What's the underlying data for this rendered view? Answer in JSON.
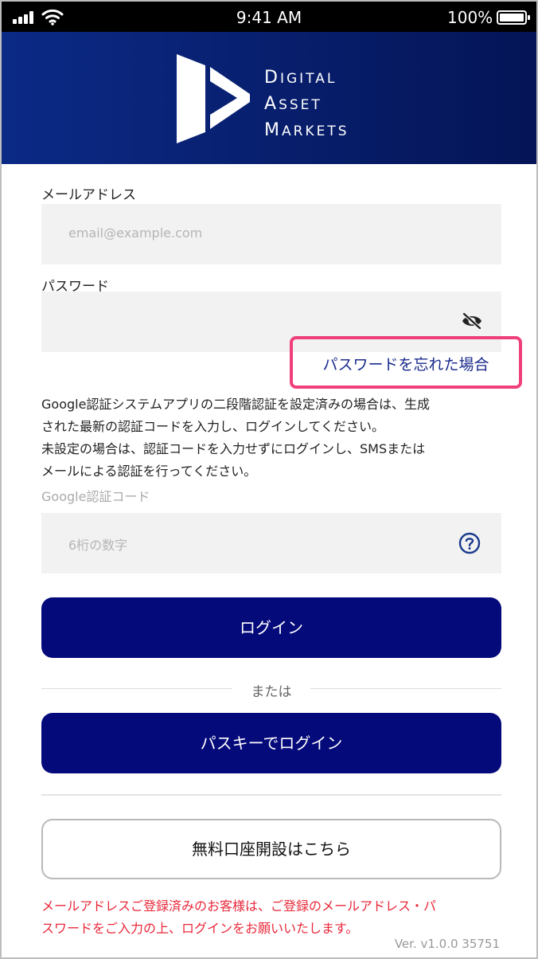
{
  "status_bar": {
    "time": "9:41 AM",
    "battery": "100%"
  },
  "logo": {
    "line1": [
      "D",
      "IGITAL"
    ],
    "line2": [
      "A",
      "SSET"
    ],
    "line3": [
      "M",
      "ARKETS"
    ]
  },
  "form": {
    "email_label": "メールアドレス",
    "email_placeholder": "email@example.com",
    "email_value": "",
    "password_label": "パスワード",
    "password_value": "",
    "forgot_link": "パスワードを忘れた場合",
    "info_lines": [
      "Google認証システムアプリの二段階認証を設定済みの場合は、生成",
      "された最新の認証コードを入力し、ログインしてください。",
      "未設定の場合は、認証コードを入力せずにログインし、SMSまたは",
      "メールによる認証を行ってください。"
    ],
    "code_label": "Google認証コード",
    "code_placeholder": "6桁の数字",
    "code_value": ""
  },
  "buttons": {
    "login": "ログイン",
    "or": "または",
    "passkey_login": "パスキーでログイン",
    "open_account": "無料口座開設はこちら"
  },
  "notice_lines": [
    "メールアドレスご登録済みのお客様は、ご登録のメールアドレス・パ",
    "スワードをご入力の上、ログインをお願いいたします。"
  ],
  "version": "Ver. v1.0.0 35751",
  "icons": {
    "password_toggle": "eye-slash-icon",
    "code_help": "question-circle-icon"
  },
  "colors": {
    "primary": "#050a7a",
    "header_dark": "#041456",
    "header_light": "#0b2a86",
    "link": "#1a2a8c",
    "highlight": "#f0407a",
    "notice": "#e8283a"
  }
}
